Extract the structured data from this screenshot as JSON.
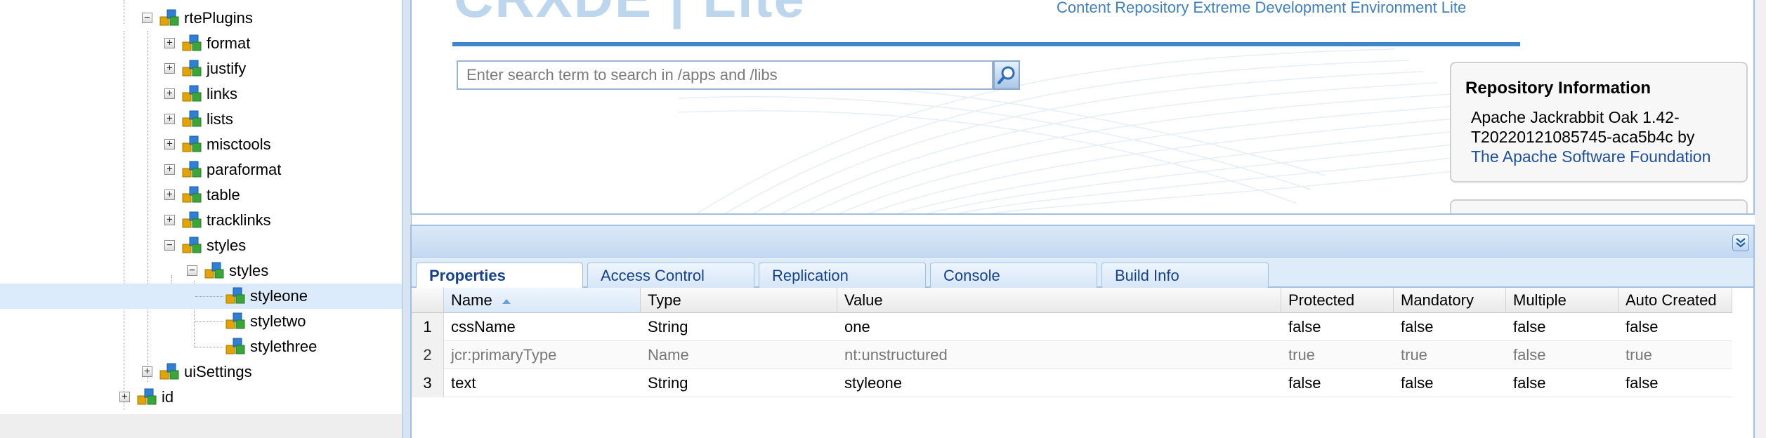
{
  "colors": {
    "accent": "#3f86c8",
    "link": "#1f4fa0",
    "tab_text": "#15428b",
    "selected_row": "#dcebfb"
  },
  "tree": {
    "nodes": [
      {
        "label": "rtePlugins",
        "toggle": "−"
      },
      {
        "label": "format",
        "toggle": "+"
      },
      {
        "label": "justify",
        "toggle": "+"
      },
      {
        "label": "links",
        "toggle": "+"
      },
      {
        "label": "lists",
        "toggle": "+"
      },
      {
        "label": "misctools",
        "toggle": "+"
      },
      {
        "label": "paraformat",
        "toggle": "+"
      },
      {
        "label": "table",
        "toggle": "+"
      },
      {
        "label": "tracklinks",
        "toggle": "+"
      },
      {
        "label": "styles",
        "toggle": "−"
      },
      {
        "label": "styles",
        "toggle": "−"
      },
      {
        "label": "styleone",
        "toggle": ""
      },
      {
        "label": "styletwo",
        "toggle": ""
      },
      {
        "label": "stylethree",
        "toggle": ""
      },
      {
        "label": "uiSettings",
        "toggle": "+"
      },
      {
        "label": "id",
        "toggle": "+"
      }
    ],
    "node_icon": "node-icon"
  },
  "header": {
    "logo_text": "CRXDE | Lite",
    "tagline": "Content Repository Extreme Development Environment Lite"
  },
  "search": {
    "placeholder": "Enter search term to search in /apps and /libs",
    "button_icon": "magnifier-icon"
  },
  "repository": {
    "title": "Repository Information",
    "line1": "Apache Jackrabbit Oak 1.42-",
    "line2": "T20220121085745-aca5b4c by",
    "vendor": "The Apache Software Foundation"
  },
  "tabs": [
    {
      "label": "Properties",
      "active": true
    },
    {
      "label": "Access Control",
      "active": false
    },
    {
      "label": "Replication",
      "active": false
    },
    {
      "label": "Console",
      "active": false
    },
    {
      "label": "Build Info",
      "active": false
    }
  ],
  "properties": {
    "columns": [
      "Name",
      "Type",
      "Value",
      "Protected",
      "Mandatory",
      "Multiple",
      "Auto Created"
    ],
    "sort_column": "Name",
    "sort_direction": "ascending",
    "rows": [
      {
        "n": "1",
        "name": "cssName",
        "type": "String",
        "value": "one",
        "protected": "false",
        "mandatory": "false",
        "multiple": "false",
        "auto": "false"
      },
      {
        "n": "2",
        "name": "jcr:primaryType",
        "type": "Name",
        "value": "nt:unstructured",
        "protected": "true",
        "mandatory": "true",
        "multiple": "false",
        "auto": "true"
      },
      {
        "n": "3",
        "name": "text",
        "type": "String",
        "value": "styleone",
        "protected": "false",
        "mandatory": "false",
        "multiple": "false",
        "auto": "false"
      }
    ]
  }
}
